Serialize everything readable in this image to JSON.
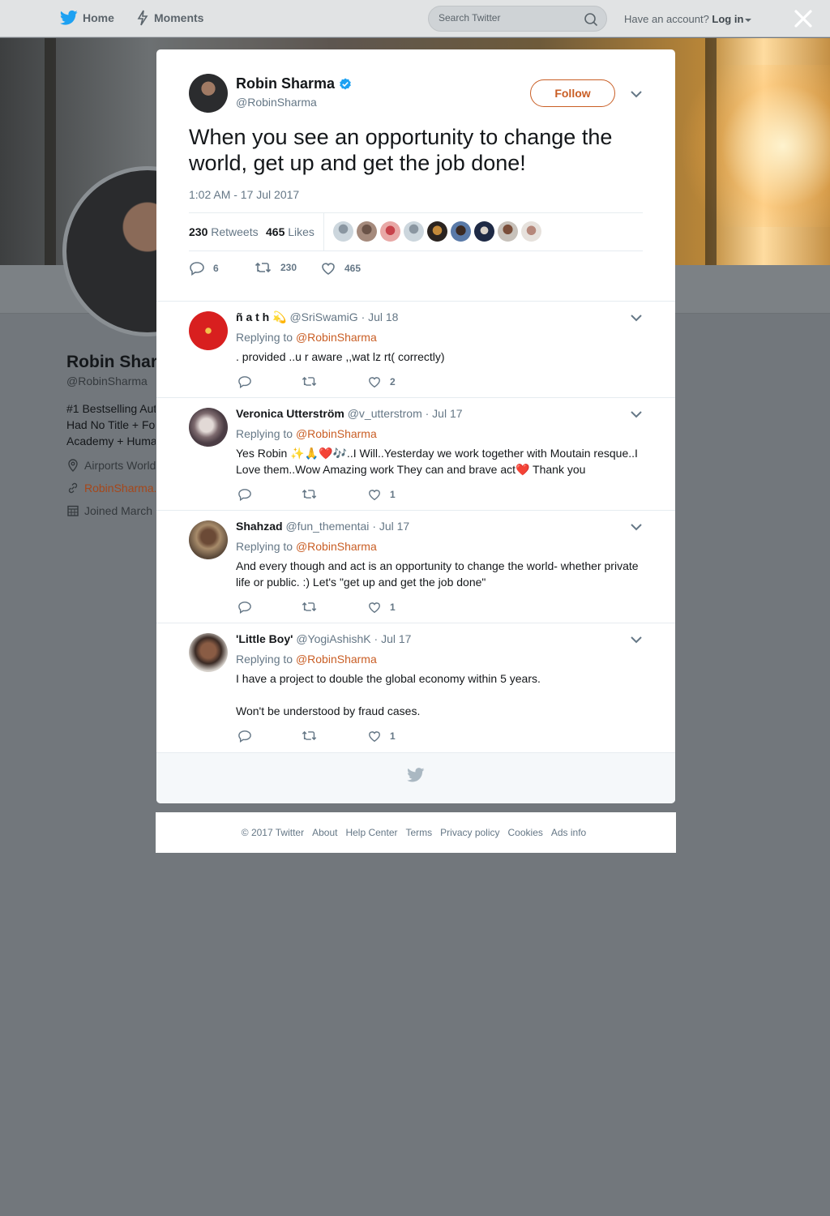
{
  "nav": {
    "home_label": "Home",
    "moments_label": "Moments",
    "search_placeholder": "Search Twitter",
    "account_prompt": "Have an account?",
    "login_label": "Log in"
  },
  "profile": {
    "name": "Robin Shar",
    "handle": "@RobinSharma",
    "bio_line1": "#1 Bestselling Aut",
    "bio_line2": "Had No Title + Fo",
    "bio_line3": "Academy + Huma",
    "location": "Airports World",
    "website": "RobinSharma.",
    "joined": "Joined March"
  },
  "tweet": {
    "author_name": "Robin Sharma",
    "author_handle": "@RobinSharma",
    "follow_label": "Follow",
    "text": "When you see an opportunity to change the world, get up and get the job done!",
    "time": "1:02 AM - 17 Jul 2017",
    "retweets_count": "230",
    "retweets_label": "Retweets",
    "likes_count": "465",
    "likes_label": "Likes",
    "reply_count": "6",
    "retweet_action_count": "230",
    "like_action_count": "465"
  },
  "colors": {
    "accent": "#c95e25",
    "verified": "#1da1f2",
    "overlay": "#72777c"
  },
  "replies": [
    {
      "name": "ñ a t h ",
      "emoji": "💫",
      "handle": "@SriSwamiG",
      "date": "· Jul 18",
      "replying_prefix": "Replying to",
      "replying_to": "@RobinSharma",
      "text": ". provided ..u r aware ,,wat lz rt( correctly)",
      "likes": "2"
    },
    {
      "name": "Veronica Utterström",
      "handle": "@v_utterstrom",
      "date": "· Jul 17",
      "replying_prefix": "Replying to",
      "replying_to": "@RobinSharma",
      "text": "Yes Robin ✨🙏❤️🎶..I Will..Yesterday we work together with Moutain resque..I Love them..Wow Amazing work They can and brave act❤️ Thank you",
      "likes": "1"
    },
    {
      "name": "Shahzad",
      "handle": "@fun_thementai",
      "date": "· Jul 17",
      "replying_prefix": "Replying to",
      "replying_to": "@RobinSharma",
      "text": "And every though and act is an opportunity to change the world- whether private life or public. :) Let's \"get up and get the job done\"",
      "likes": "1"
    },
    {
      "name": "'Little Boy'",
      "handle": "@YogiAshishK",
      "date": "· Jul 17",
      "replying_prefix": "Replying to",
      "replying_to": "@RobinSharma",
      "text": "I have a project to double the global economy within 5 years.",
      "text2": "Won't be understood by fraud cases.",
      "likes": "1"
    }
  ],
  "footer": {
    "copyright": "© 2017 Twitter",
    "about": "About",
    "help": "Help Center",
    "terms": "Terms",
    "privacy": "Privacy policy",
    "cookies": "Cookies",
    "ads": "Ads info"
  }
}
